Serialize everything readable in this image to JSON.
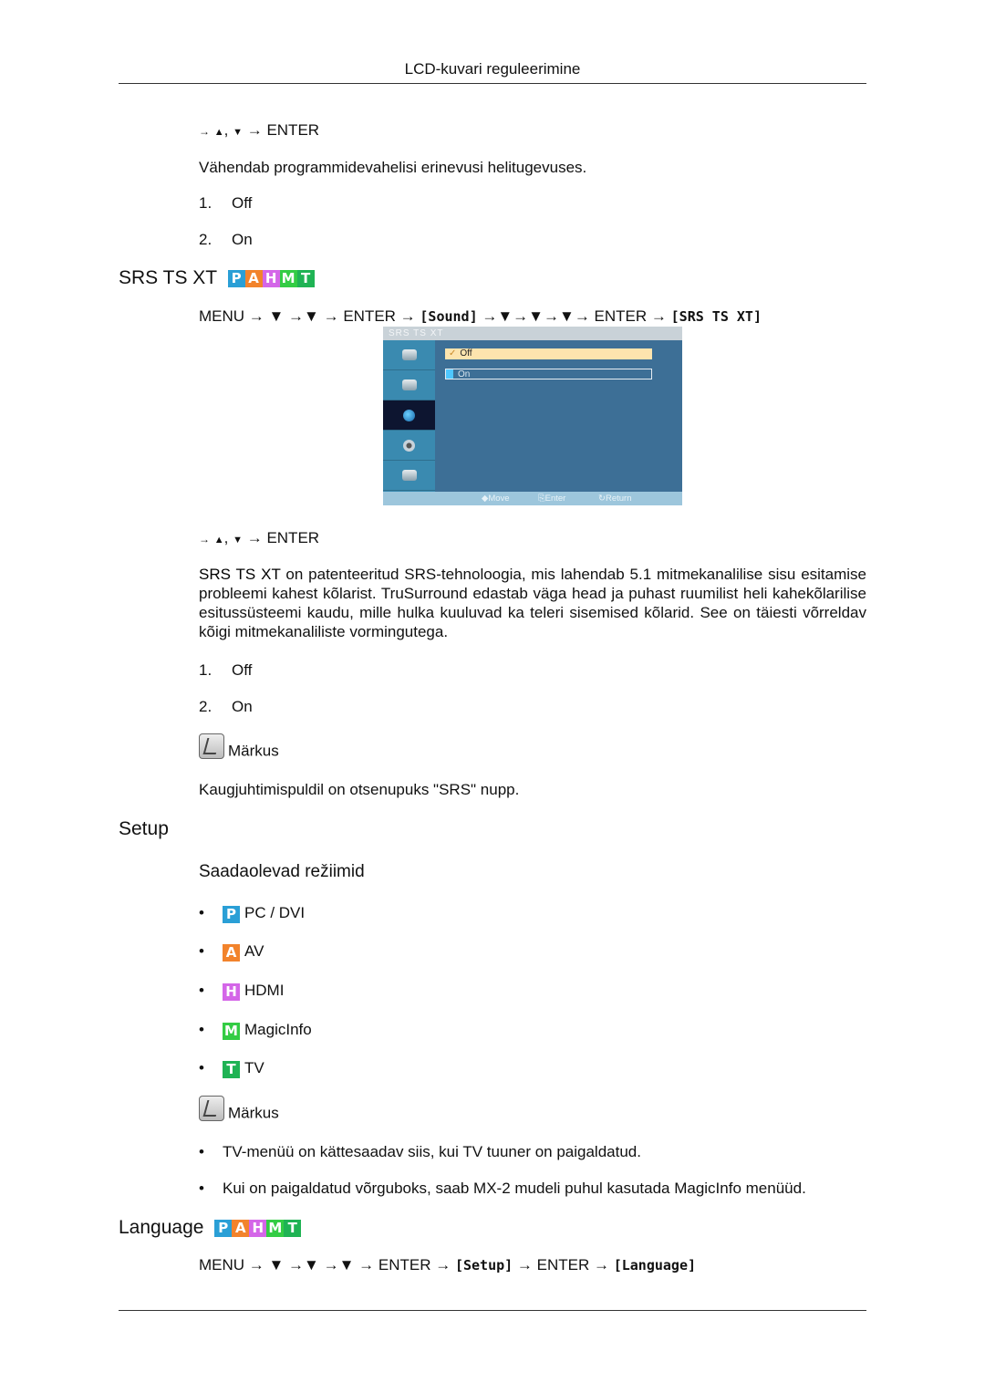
{
  "header": {
    "title": "LCD-kuvari reguleerimine"
  },
  "section1": {
    "nav": {
      "arrow": "→",
      "up": "▲",
      "sep": ",",
      "down": "▼",
      "enter": "→ ENTER"
    },
    "description": "Vähendab programmidevahelisi erinevusi helitugevuses.",
    "options": [
      {
        "num": "1.",
        "label": "Off"
      },
      {
        "num": "2.",
        "label": "On"
      }
    ]
  },
  "srs": {
    "title": "SRS TS XT",
    "badges": [
      "P",
      "A",
      "H",
      "M",
      "T"
    ],
    "path": {
      "prefix": "MENU → ▼ →▼ → ENTER →",
      "bracket1": "[Sound]",
      "middle": "→▼→▼→▼→ ENTER →",
      "bracket2": "[SRS TS XT]"
    },
    "osd": {
      "title": "SRS TS XT",
      "options": [
        {
          "label": "Off",
          "selected": true,
          "check": "✓"
        },
        {
          "label": "On",
          "selected": false
        }
      ],
      "footer": {
        "move": "Move",
        "enter": "Enter",
        "return": "Return"
      }
    },
    "nav": {
      "arrow": "→",
      "up": "▲",
      "sep": ",",
      "down": "▼",
      "enter": "→ ENTER"
    },
    "description_lead": "SRS TS XT",
    "description": " on patenteeritud SRS-tehnoloogia, mis lahendab 5.1 mitmekanalilise sisu esitamise probleemi kahest kõlarist. TruSurround edastab väga head ja puhast ruumilist heli kahekõlarilise esitussüsteemi kaudu, mille hulka kuuluvad ka teleri sisemised kõlarid. See on täiesti võrreldav kõigi mitmekanaliliste vormingutega.",
    "options": [
      {
        "num": "1.",
        "label": "Off"
      },
      {
        "num": "2.",
        "label": "On"
      }
    ],
    "note_label": "Märkus",
    "note_text": "Kaugjuhtimispuldil on otsenupuks \"SRS\" nupp."
  },
  "setup": {
    "title": "Setup",
    "subtitle": "Saadaolevad režiimid",
    "modes": [
      {
        "badge": "P",
        "label": "PC / DVI",
        "color": "#2a9fd6"
      },
      {
        "badge": "A",
        "label": "AV",
        "color": "#f2832c"
      },
      {
        "badge": "H",
        "label": "HDMI",
        "color": "#d466e8"
      },
      {
        "badge": "M",
        "label": "MagicInfo",
        "color": "#33cc44"
      },
      {
        "badge": "T",
        "label": "TV",
        "color": "#1fb354"
      }
    ],
    "note_label": "Märkus",
    "notes": [
      "TV-menüü on kättesaadav siis, kui TV tuuner on paigaldatud.",
      "Kui on paigaldatud võrguboks, saab MX-2 mudeli puhul kasutada MagicInfo menüüd."
    ],
    "bullet": "•"
  },
  "language": {
    "title": "Language",
    "badges": [
      "P",
      "A",
      "H",
      "M",
      "T"
    ],
    "path": {
      "prefix": "MENU → ▼ →▼ →▼ → ENTER →",
      "bracket1": "[Setup]",
      "middle": "→ ENTER →",
      "bracket2": "[Language]"
    }
  }
}
